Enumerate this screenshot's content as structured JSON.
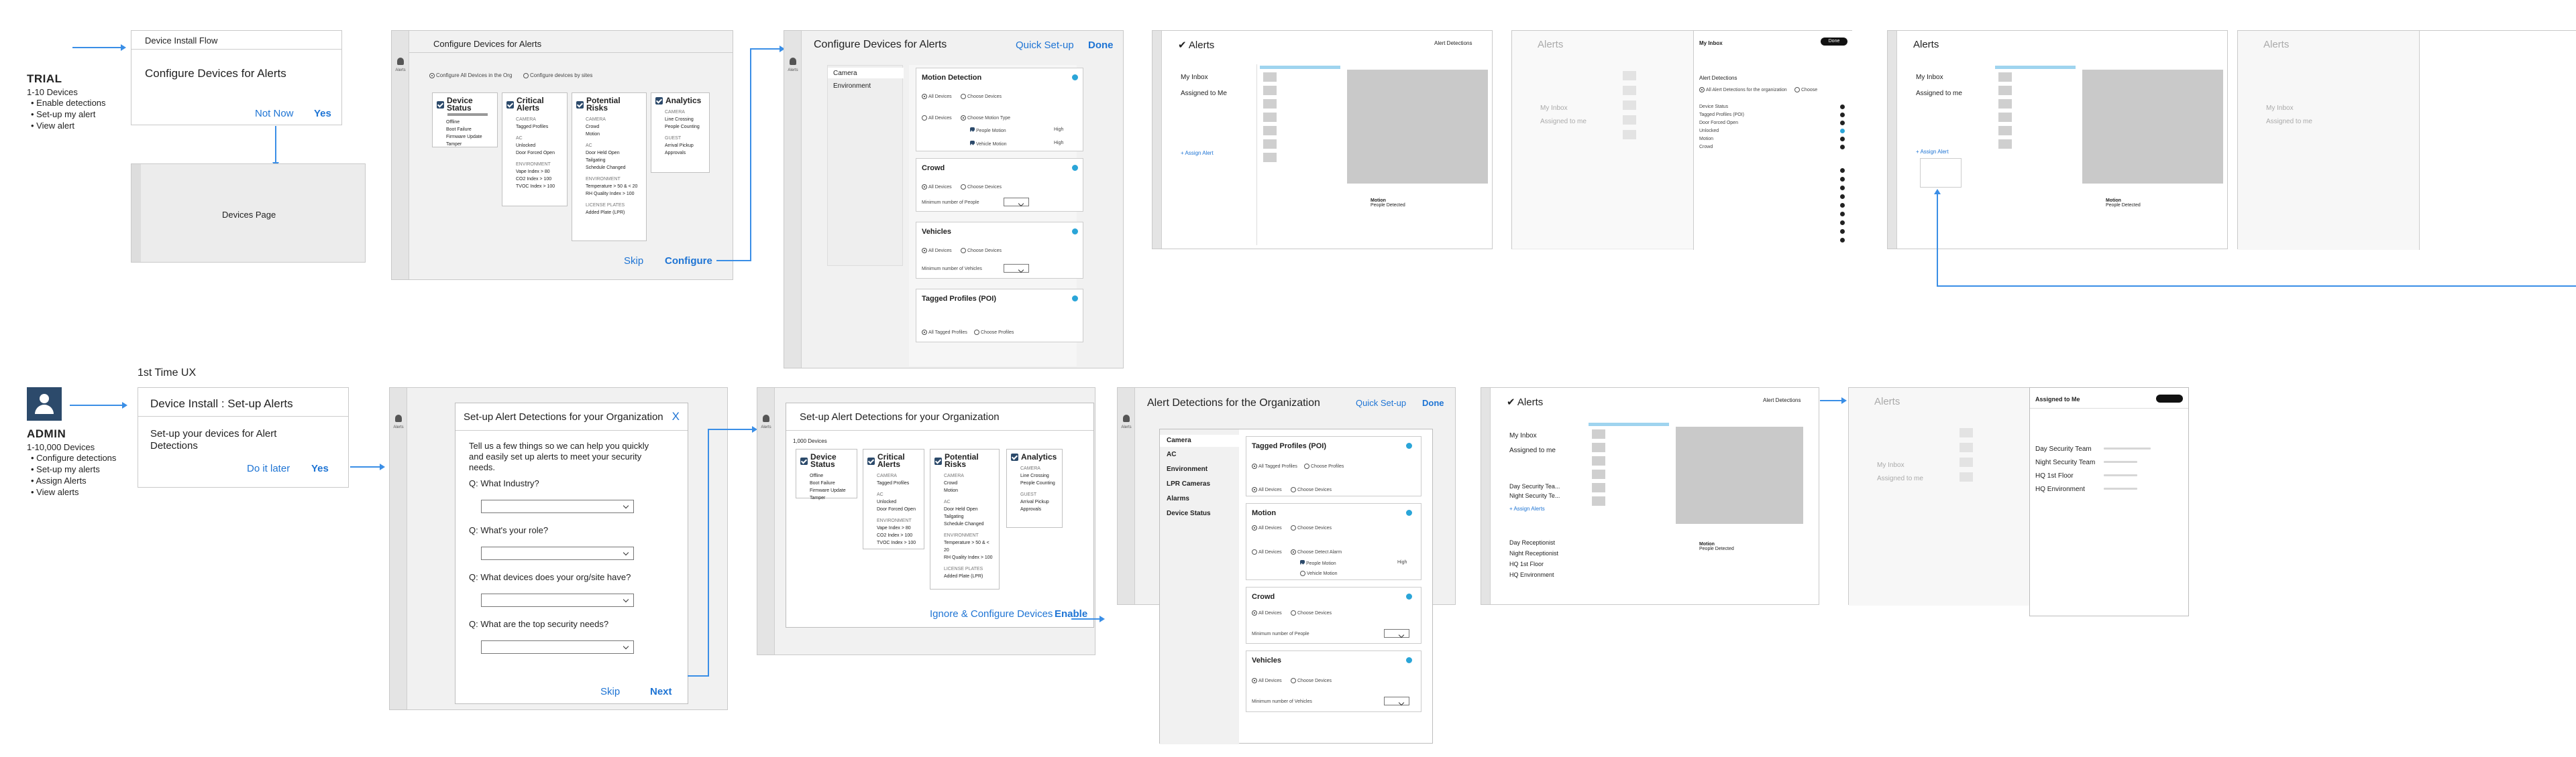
{
  "trial": {
    "title": "TRIAL",
    "devices": "1-10 Devices",
    "bullets": [
      "Enable detections",
      "Set-up my alert",
      "View alert"
    ]
  },
  "admin": {
    "title": "ADMIN",
    "devices": "1-10,000 Devices",
    "bullets": [
      "Configure detections",
      "Set-up my alerts",
      "Assign Alerts",
      "View alerts"
    ],
    "first_ux": "1st Time UX"
  },
  "rail_label": "Alerts",
  "trial_flow": {
    "dialog_header": "Device Install Flow",
    "dialog_title": "Configure Devices for Alerts",
    "not_now": "Not Now",
    "yes": "Yes",
    "devices_page": "Devices Page"
  },
  "configure_devices": {
    "title": "Configure Devices for Alerts",
    "option_all": "Configure All Devices in the Org",
    "option_sites": "Configure devices by sites",
    "skip": "Skip",
    "configure": "Configure",
    "categories": [
      {
        "name": "Device Status",
        "lines": [
          "Offline",
          "Boot Failure",
          "Firmware Update",
          "Tamper"
        ]
      },
      {
        "name": "Critical Alerts",
        "sub1": "CAMERA",
        "lines": [
          "Tagged Profiles"
        ],
        "sub2": "AC",
        "lines2": [
          "Unlocked",
          "Door Forced Open"
        ],
        "sub3": "ENVIRONMENT",
        "lines3": [
          "Vape Index > 80",
          "CO2 Index > 100",
          "TVOC Index > 100"
        ]
      },
      {
        "name": "Potential Risks",
        "sub1": "CAMERA",
        "lines": [
          "Crowd",
          "Motion"
        ],
        "sub2": "AC",
        "lines2": [
          "Door Held Open",
          "Tailgating",
          "Schedule Changed"
        ],
        "sub3": "ENVIRONMENT",
        "lines3": [
          "Temperature > 50 & < 20",
          "RH Quality Index > 100"
        ],
        "sub4": "LICENSE PLATES",
        "lines4": [
          "Added Plate (LPR)"
        ]
      },
      {
        "name": "Analytics",
        "sub1": "CAMERA",
        "lines": [
          "Line Crossing",
          "People Counting"
        ],
        "sub2": "GUEST",
        "lines2": [
          "Arrival Pickup",
          "Approvals"
        ]
      }
    ]
  },
  "configure_alerts": {
    "title": "Configure Devices for Alerts",
    "quick_setup": "Quick Set-up",
    "done": "Done",
    "tabs": [
      "Camera",
      "Environment"
    ],
    "motion": "Motion Detection",
    "all_devices": "All Devices",
    "choose_devices": "Choose Devices",
    "choose_motion": "Choose Motion Type",
    "people_motion": "People Motion",
    "vehicle_motion": "Vehicle Motion",
    "crowd": "Crowd",
    "min_people": "Minimum number of People",
    "vehicles": "Vehicles",
    "min_vehicles": "Minimum number of Vehicles",
    "tagged": "Tagged Profiles (POI)",
    "all_tagged": "All Tagged Profiles",
    "choose_profiles": "Choose Profiles",
    "high": "High"
  },
  "alerts_app": {
    "title": "Alerts",
    "alert_detections": "Alert Detections",
    "my_inbox": "My Inbox",
    "assigned": "Assigned to Me",
    "assigned_lower": "Assigned to me",
    "assign_alert": "+ Assign Alert",
    "assign_alerts": "+ Assign Alerts",
    "motion_title": "Motion",
    "people_detected": "People Detected"
  },
  "detections_panel": {
    "title": "Alert Detections",
    "enable_all": "All Alert Detections for the organization",
    "choose": "Choose",
    "done": "Done",
    "items": [
      "Device Status",
      "Tagged Profiles (POI)",
      "Door Forced Open",
      "Unlocked",
      "Motion",
      "Crowd"
    ]
  },
  "admin_setup": {
    "dialog_title": "Device Install : Set-up Alerts",
    "dialog_body": "Set-up your devices for Alert Detections",
    "later": "Do it later",
    "yes": "Yes",
    "q_title": "Set-up Alert Detections  for your Organization",
    "close": "X",
    "intro": "Tell us a few things so we can help you quickly and easily set up alerts to meet your security needs.",
    "questions": [
      "Q: What Industry?",
      "Q: What's your role?",
      "Q: What devices does your org/site have?",
      "Q: What are the top security needs?"
    ],
    "skip": "Skip",
    "next": "Next"
  },
  "admin_configure": {
    "title": "Set-up Alert Detections  for your Organization",
    "devices": "1,000 Devices",
    "ignore": "Ignore & Configure Devices",
    "enable": "Enable"
  },
  "org_detections": {
    "title": "Alert Detections for the Organization",
    "quick_setup": "Quick Set-up",
    "done": "Done",
    "tabs": [
      "Camera",
      "AC",
      "Environment",
      "LPR Cameras",
      "Alarms",
      "Device Status"
    ],
    "tagged": "Tagged Profiles (POI)",
    "motion": "Motion",
    "crowd": "Crowd",
    "vehicles": "Vehicles",
    "min_people": "Minimum number of People",
    "min_vehicles": "Minimum number of Vehicles",
    "choose_detect": "Choose Detect Alarm",
    "people_motion": "People Motion",
    "vehicle_motion": "Vehicle Motion",
    "high": "High"
  },
  "admin_alerts": {
    "groups": [
      "Day Security Tea...",
      "Night Security Te..."
    ],
    "assign_alerts": "+ Assign Alerts",
    "teams": [
      "Day Receptionist",
      "Night Receptionist",
      "HQ 1st Floor",
      "HQ Environment"
    ]
  },
  "assigned_panel": {
    "title": "Assigned to Me",
    "rows": [
      "Day Security Team",
      "Night Security Team",
      "HQ 1st Floor",
      "HQ Environment"
    ]
  },
  "colors": {
    "accent": "#1e74d4",
    "connector": "#3a8ee6",
    "dot": "#2aa5d8"
  }
}
